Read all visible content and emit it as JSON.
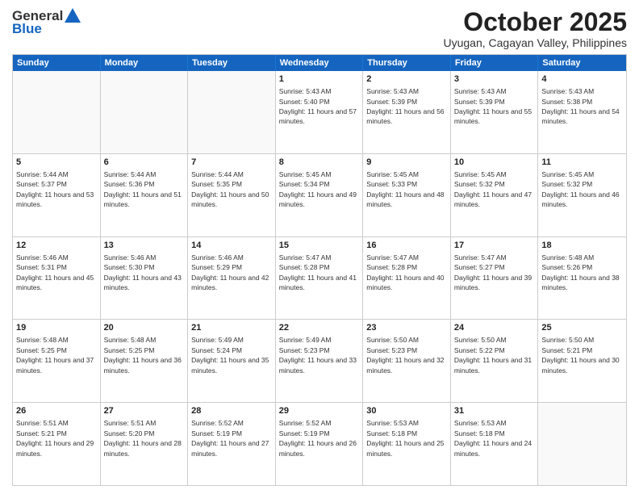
{
  "logo": {
    "line1": "General",
    "line2": "Blue"
  },
  "title": "October 2025",
  "location": "Uyugan, Cagayan Valley, Philippines",
  "header_days": [
    "Sunday",
    "Monday",
    "Tuesday",
    "Wednesday",
    "Thursday",
    "Friday",
    "Saturday"
  ],
  "rows": [
    [
      {
        "day": "",
        "sunrise": "",
        "sunset": "",
        "daylight": ""
      },
      {
        "day": "",
        "sunrise": "",
        "sunset": "",
        "daylight": ""
      },
      {
        "day": "",
        "sunrise": "",
        "sunset": "",
        "daylight": ""
      },
      {
        "day": "1",
        "sunrise": "Sunrise: 5:43 AM",
        "sunset": "Sunset: 5:40 PM",
        "daylight": "Daylight: 11 hours and 57 minutes."
      },
      {
        "day": "2",
        "sunrise": "Sunrise: 5:43 AM",
        "sunset": "Sunset: 5:39 PM",
        "daylight": "Daylight: 11 hours and 56 minutes."
      },
      {
        "day": "3",
        "sunrise": "Sunrise: 5:43 AM",
        "sunset": "Sunset: 5:39 PM",
        "daylight": "Daylight: 11 hours and 55 minutes."
      },
      {
        "day": "4",
        "sunrise": "Sunrise: 5:43 AM",
        "sunset": "Sunset: 5:38 PM",
        "daylight": "Daylight: 11 hours and 54 minutes."
      }
    ],
    [
      {
        "day": "5",
        "sunrise": "Sunrise: 5:44 AM",
        "sunset": "Sunset: 5:37 PM",
        "daylight": "Daylight: 11 hours and 53 minutes."
      },
      {
        "day": "6",
        "sunrise": "Sunrise: 5:44 AM",
        "sunset": "Sunset: 5:36 PM",
        "daylight": "Daylight: 11 hours and 51 minutes."
      },
      {
        "day": "7",
        "sunrise": "Sunrise: 5:44 AM",
        "sunset": "Sunset: 5:35 PM",
        "daylight": "Daylight: 11 hours and 50 minutes."
      },
      {
        "day": "8",
        "sunrise": "Sunrise: 5:45 AM",
        "sunset": "Sunset: 5:34 PM",
        "daylight": "Daylight: 11 hours and 49 minutes."
      },
      {
        "day": "9",
        "sunrise": "Sunrise: 5:45 AM",
        "sunset": "Sunset: 5:33 PM",
        "daylight": "Daylight: 11 hours and 48 minutes."
      },
      {
        "day": "10",
        "sunrise": "Sunrise: 5:45 AM",
        "sunset": "Sunset: 5:32 PM",
        "daylight": "Daylight: 11 hours and 47 minutes."
      },
      {
        "day": "11",
        "sunrise": "Sunrise: 5:45 AM",
        "sunset": "Sunset: 5:32 PM",
        "daylight": "Daylight: 11 hours and 46 minutes."
      }
    ],
    [
      {
        "day": "12",
        "sunrise": "Sunrise: 5:46 AM",
        "sunset": "Sunset: 5:31 PM",
        "daylight": "Daylight: 11 hours and 45 minutes."
      },
      {
        "day": "13",
        "sunrise": "Sunrise: 5:46 AM",
        "sunset": "Sunset: 5:30 PM",
        "daylight": "Daylight: 11 hours and 43 minutes."
      },
      {
        "day": "14",
        "sunrise": "Sunrise: 5:46 AM",
        "sunset": "Sunset: 5:29 PM",
        "daylight": "Daylight: 11 hours and 42 minutes."
      },
      {
        "day": "15",
        "sunrise": "Sunrise: 5:47 AM",
        "sunset": "Sunset: 5:28 PM",
        "daylight": "Daylight: 11 hours and 41 minutes."
      },
      {
        "day": "16",
        "sunrise": "Sunrise: 5:47 AM",
        "sunset": "Sunset: 5:28 PM",
        "daylight": "Daylight: 11 hours and 40 minutes."
      },
      {
        "day": "17",
        "sunrise": "Sunrise: 5:47 AM",
        "sunset": "Sunset: 5:27 PM",
        "daylight": "Daylight: 11 hours and 39 minutes."
      },
      {
        "day": "18",
        "sunrise": "Sunrise: 5:48 AM",
        "sunset": "Sunset: 5:26 PM",
        "daylight": "Daylight: 11 hours and 38 minutes."
      }
    ],
    [
      {
        "day": "19",
        "sunrise": "Sunrise: 5:48 AM",
        "sunset": "Sunset: 5:25 PM",
        "daylight": "Daylight: 11 hours and 37 minutes."
      },
      {
        "day": "20",
        "sunrise": "Sunrise: 5:48 AM",
        "sunset": "Sunset: 5:25 PM",
        "daylight": "Daylight: 11 hours and 36 minutes."
      },
      {
        "day": "21",
        "sunrise": "Sunrise: 5:49 AM",
        "sunset": "Sunset: 5:24 PM",
        "daylight": "Daylight: 11 hours and 35 minutes."
      },
      {
        "day": "22",
        "sunrise": "Sunrise: 5:49 AM",
        "sunset": "Sunset: 5:23 PM",
        "daylight": "Daylight: 11 hours and 33 minutes."
      },
      {
        "day": "23",
        "sunrise": "Sunrise: 5:50 AM",
        "sunset": "Sunset: 5:23 PM",
        "daylight": "Daylight: 11 hours and 32 minutes."
      },
      {
        "day": "24",
        "sunrise": "Sunrise: 5:50 AM",
        "sunset": "Sunset: 5:22 PM",
        "daylight": "Daylight: 11 hours and 31 minutes."
      },
      {
        "day": "25",
        "sunrise": "Sunrise: 5:50 AM",
        "sunset": "Sunset: 5:21 PM",
        "daylight": "Daylight: 11 hours and 30 minutes."
      }
    ],
    [
      {
        "day": "26",
        "sunrise": "Sunrise: 5:51 AM",
        "sunset": "Sunset: 5:21 PM",
        "daylight": "Daylight: 11 hours and 29 minutes."
      },
      {
        "day": "27",
        "sunrise": "Sunrise: 5:51 AM",
        "sunset": "Sunset: 5:20 PM",
        "daylight": "Daylight: 11 hours and 28 minutes."
      },
      {
        "day": "28",
        "sunrise": "Sunrise: 5:52 AM",
        "sunset": "Sunset: 5:19 PM",
        "daylight": "Daylight: 11 hours and 27 minutes."
      },
      {
        "day": "29",
        "sunrise": "Sunrise: 5:52 AM",
        "sunset": "Sunset: 5:19 PM",
        "daylight": "Daylight: 11 hours and 26 minutes."
      },
      {
        "day": "30",
        "sunrise": "Sunrise: 5:53 AM",
        "sunset": "Sunset: 5:18 PM",
        "daylight": "Daylight: 11 hours and 25 minutes."
      },
      {
        "day": "31",
        "sunrise": "Sunrise: 5:53 AM",
        "sunset": "Sunset: 5:18 PM",
        "daylight": "Daylight: 11 hours and 24 minutes."
      },
      {
        "day": "",
        "sunrise": "",
        "sunset": "",
        "daylight": ""
      }
    ]
  ]
}
